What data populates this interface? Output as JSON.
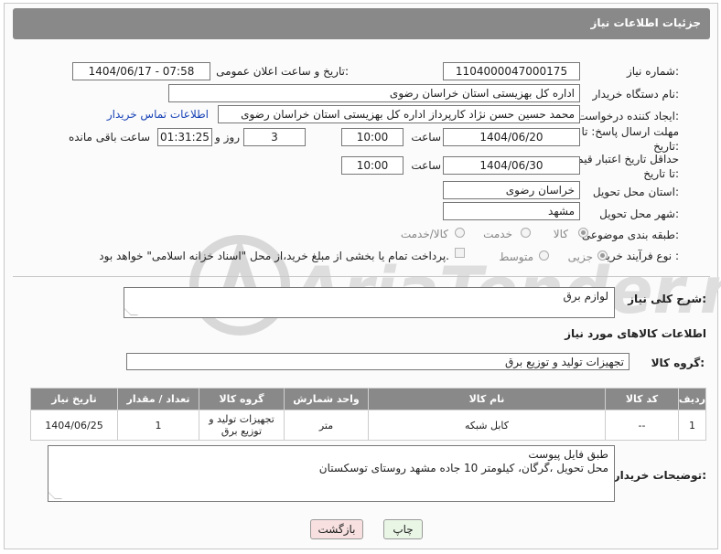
{
  "header": {
    "title": "جزئیات اطلاعات نیاز"
  },
  "fields": {
    "need_number_label": "شماره نیاز:",
    "need_number": "1104000047000175",
    "announce_label": "تاریخ و ساعت اعلان عمومی:",
    "announce_value": "1404/06/17 - 07:58",
    "buyer_org_label": "نام دستگاه خریدار:",
    "buyer_org": "اداره کل بهزیستی استان خراسان رضوی",
    "creator_label": "ایجاد کننده درخواست:",
    "creator": "محمد حسین حسن نژاد کارپرداز اداره کل بهزیستی استان خراسان رضوی",
    "contact_link": "اطلاعات تماس خریدار",
    "reply_deadline_label": "مهلت ارسال پاسخ: تا تاریخ:",
    "reply_date": "1404/06/20",
    "time_label": "ساعت",
    "reply_time": "10:00",
    "days_value": "3",
    "days_label": "روز و",
    "remaining_time": "01:31:25",
    "remaining_label": "ساعت باقی مانده",
    "price_validity_label": "حداقل تاریخ اعتبار قیمت: تا تاریخ:",
    "price_date": "1404/06/30",
    "price_time": "10:00",
    "province_label": "استان محل تحویل:",
    "province": "خراسان رضوی",
    "city_label": "شهر محل تحویل:",
    "city": "مشهد",
    "category_label": "طبقه بندی موضوعی:",
    "category_options": [
      "کالا",
      "خدمت",
      "کالا/خدمت"
    ],
    "process_label": "نوع فرآیند خرید :",
    "process_options": [
      "جزیی",
      "متوسط"
    ],
    "payment_note": "پرداخت تمام یا بخشی از مبلغ خرید،از محل \"اسناد خزانه اسلامی\" خواهد بود."
  },
  "description": {
    "label": "شرح کلی نیاز:",
    "value": "لوازم برق"
  },
  "goods_section": {
    "title": "اطلاعات کالاهای مورد نیاز",
    "group_label": "گروه کالا:",
    "group_value": "تجهیزات تولید و توزیع برق"
  },
  "table": {
    "headers": [
      "ردیف",
      "کد کالا",
      "نام کالا",
      "واحد شمارش",
      "گروه کالا",
      "تعداد / مقدار",
      "تاریخ نیاز"
    ],
    "rows": [
      [
        "1",
        "--",
        "کابل شبکه",
        "متر",
        "تجهیزات تولید و توزیع برق",
        "1",
        "1404/06/25"
      ]
    ]
  },
  "buyer_notes": {
    "label": "توضیحات خریدار:",
    "line1": "طبق فایل پیوست",
    "line2": "محل تحویل ،گرگان، کیلومتر 10 جاده مشهد روستای توسکستان"
  },
  "buttons": {
    "print": "چاپ",
    "back": "بازگشت"
  },
  "watermark": {
    "text": "AriaTender.net"
  },
  "colors": {
    "header_bg": "#898989",
    "link": "#1a44b8",
    "print_btn": "#e9f6e6",
    "back_btn": "#f8e0e0"
  }
}
